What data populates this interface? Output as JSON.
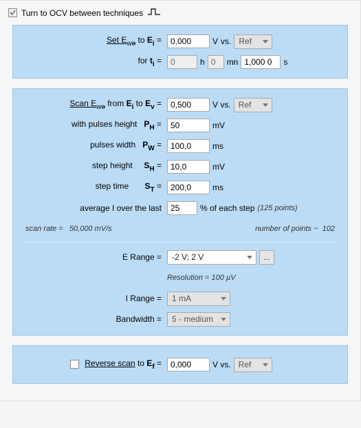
{
  "header": {
    "ocv_label": "Turn to OCV between techniques",
    "ocv_checked": true
  },
  "panel_set": {
    "set_label": "Set E",
    "set_sub": "we",
    "to_label": " to ",
    "ei_label": "E",
    "ei_sub": "i",
    "eq": " = ",
    "ei_value": "0,000",
    "unit_v": "V",
    "vs": "vs.",
    "ref_selected": "Ref",
    "for_label": "for ",
    "ti_label": "t",
    "ti_sub": "i",
    "ti_h_value": "0",
    "unit_h": "h",
    "ti_mn_value": "0",
    "unit_mn": "mn",
    "ti_s_value": "1,000 0",
    "unit_s": "s"
  },
  "panel_scan": {
    "scan_label": "Scan E",
    "scan_sub": "we",
    "from_label": " from ",
    "ei_label": "E",
    "ei_sub": "i",
    "to_label": " to ",
    "ev_label": "E",
    "ev_sub": "v",
    "eq": " = ",
    "ev_value": "0,500",
    "unit_v": "V vs.",
    "ref_selected": "Ref",
    "ph_label_pre": "with  pulses height",
    "ph_sym": "P",
    "ph_sub": "H",
    "ph_value": "50",
    "unit_mv": "mV",
    "pw_label_pre": "pulses width",
    "pw_sym": "P",
    "pw_sub": "W",
    "pw_value": "100,0",
    "unit_ms": "ms",
    "sh_label_pre": "step height",
    "sh_sym": "S",
    "sh_sub": "H",
    "sh_value": "10,0",
    "st_label_pre": "step time",
    "st_sym": "S",
    "st_sub": "T",
    "st_value": "200,0",
    "avg_label": "average I over the last",
    "avg_value": "25",
    "avg_unit": "% of each step",
    "avg_note": "(125 points)",
    "scan_rate_label": "scan rate =",
    "scan_rate_value": "50,000 mV/s",
    "num_points_label": "number of points  ~",
    "num_points_value": "102",
    "erange_label": "E Range = ",
    "erange_value": "-2 V; 2 V",
    "erange_btn": "...",
    "resolution_label": "Resolution = 100 µV",
    "irange_label": "I Range = ",
    "irange_value": "1 mA",
    "bw_label": "Bandwidth = ",
    "bw_value": "5 - medium"
  },
  "panel_reverse": {
    "checked": false,
    "label": "Reverse scan",
    "to_label": " to ",
    "ef_label": "E",
    "ef_sub": "f",
    "eq": " = ",
    "ef_value": "0,000",
    "unit_v": "V vs.",
    "ref_selected": "Ref"
  }
}
